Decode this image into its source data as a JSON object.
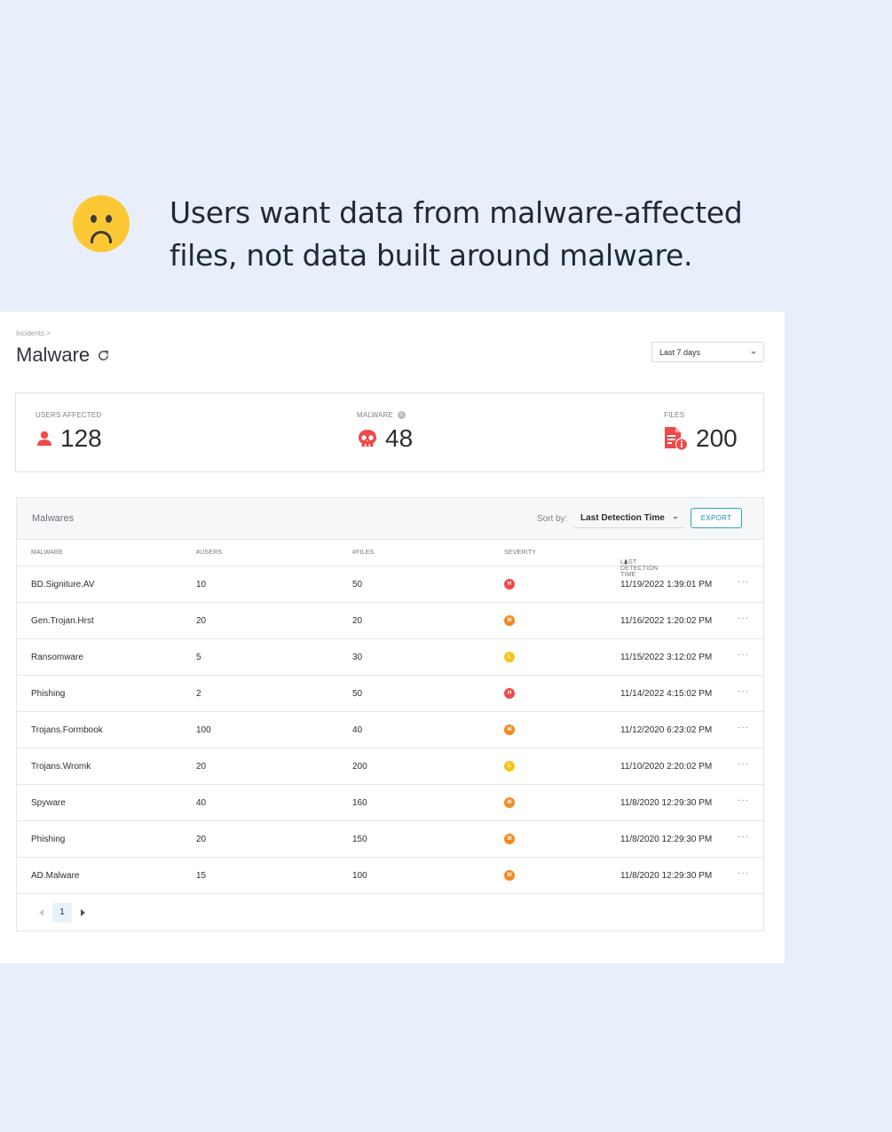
{
  "headline": "Users want data from malware-affected files, not data built around malware.",
  "emoji": "slightly-frowning-face-icon",
  "breadcrumb": "Incidents >",
  "page_title": "Malware",
  "date_range": "Last 7 days",
  "stats": {
    "users_affected": {
      "label": "USERS AFFECTED",
      "value": "128",
      "icon": "user-icon"
    },
    "malware": {
      "label": "MALWARE",
      "value": "48",
      "icon": "skull-icon"
    },
    "files": {
      "label": "FILES",
      "value": "200",
      "icon": "file-alert-icon"
    }
  },
  "table": {
    "title": "Malwares",
    "sort_label": "Sort by:",
    "sort_value": "Last Detection Time",
    "export_label": "EXPORT",
    "columns": [
      "MALWARE",
      "#USERS",
      "#FILES",
      "SEVERITY",
      "LAST DETECTION TIME"
    ],
    "rows": [
      {
        "malware": "BD.Signiture.AV",
        "users": "10",
        "files": "50",
        "severity": "H",
        "time": "11/19/2022 1:39:01 PM"
      },
      {
        "malware": "Gen.Trojan.Hrst",
        "users": "20",
        "files": "20",
        "severity": "M",
        "time": "11/16/2022 1:20:02 PM"
      },
      {
        "malware": "Ransomware",
        "users": "5",
        "files": "30",
        "severity": "L",
        "time": "11/15/2022 3:12:02 PM"
      },
      {
        "malware": "Phishing",
        "users": "2",
        "files": "50",
        "severity": "H",
        "time": "11/14/2022 4:15:02 PM"
      },
      {
        "malware": "Trojans.Formbook",
        "users": "100",
        "files": "40",
        "severity": "M",
        "time": "11/12/2020 6:23:02 PM"
      },
      {
        "malware": "Trojans.Wromk",
        "users": "20",
        "files": "200",
        "severity": "L",
        "time": "11/10/2020 2:20:02 PM"
      },
      {
        "malware": "Spyware",
        "users": "40",
        "files": "160",
        "severity": "M",
        "time": "11/8/2020 12:29:30 PM"
      },
      {
        "malware": "Phishing",
        "users": "20",
        "files": "150",
        "severity": "M",
        "time": "11/8/2020 12:29:30 PM"
      },
      {
        "malware": "AD.Malware",
        "users": "15",
        "files": "100",
        "severity": "M",
        "time": "11/8/2020 12:29:30 PM"
      }
    ],
    "row_action": "···",
    "current_page": "1"
  },
  "colors": {
    "severity_H": "#ef4a4a",
    "severity_M": "#f5891f",
    "severity_L": "#f4c518",
    "stat_icon": "#ef4a4a",
    "accent": "#26a8c4"
  }
}
